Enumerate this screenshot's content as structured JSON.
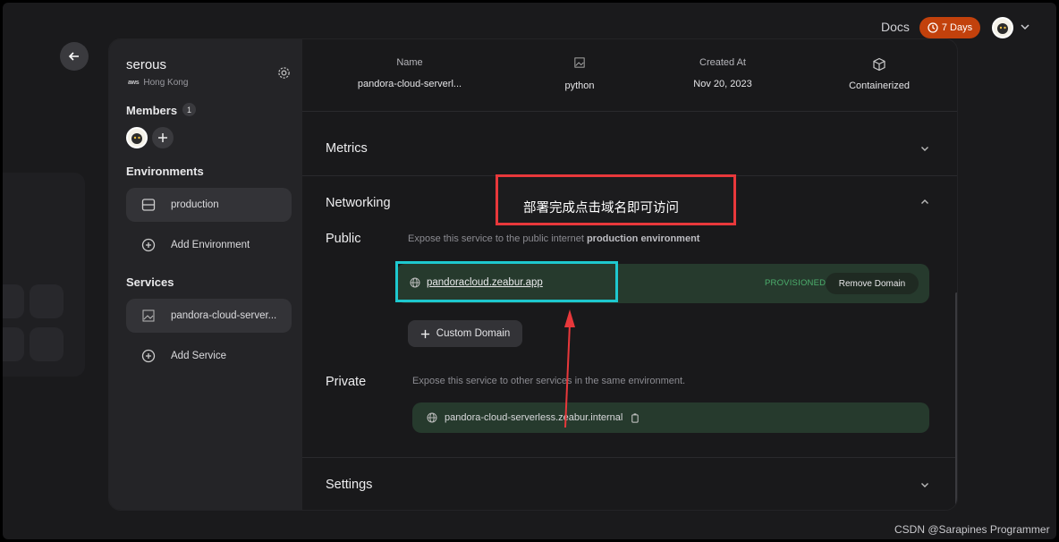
{
  "topbar": {
    "docs_label": "Docs",
    "trial_label": "7 Days",
    "colors": {
      "trial_badge": "#c2410c"
    }
  },
  "sidebar": {
    "project_name": "serous",
    "provider": "aws",
    "region": "Hong Kong",
    "members_title": "Members",
    "members_count": "1",
    "environments_title": "Environments",
    "environments": [
      {
        "label": "production",
        "icon": "server-icon",
        "active": true
      },
      {
        "label": "Add Environment",
        "icon": "plus-circle-icon",
        "active": false
      }
    ],
    "services_title": "Services",
    "services": [
      {
        "label": "pandora-cloud-server...",
        "icon": "broken-image-icon",
        "active": true
      },
      {
        "label": "Add Service",
        "icon": "plus-circle-icon",
        "active": false
      }
    ]
  },
  "service_info": {
    "name_label": "Name",
    "name_value": "pandora-cloud-serverl...",
    "language_value": "python",
    "created_label": "Created At",
    "created_value": "Nov 20, 2023",
    "runtime_value": "Containerized"
  },
  "sections": {
    "metrics": "Metrics",
    "networking": "Networking",
    "settings": "Settings"
  },
  "networking": {
    "public_title": "Public",
    "public_desc": "Expose this service to the public internet",
    "public_env": "production environment",
    "domain": "pandoracloud.zeabur.app",
    "status": "PROVISIONED",
    "remove_label": "Remove Domain",
    "custom_domain_label": "Custom Domain",
    "private_title": "Private",
    "private_desc": "Expose this service to other services in the same environment.",
    "private_host": "pandora-cloud-serverless.zeabur.internal",
    "colors": {
      "domain_bg": "#263a2d",
      "status": "#4caf6d"
    }
  },
  "annotation": {
    "note": "部署完成点击域名即可访问",
    "colors": {
      "box": "#e8383b",
      "highlight": "#1ec8cf"
    }
  },
  "watermark": "CSDN @Sarapines Programmer"
}
